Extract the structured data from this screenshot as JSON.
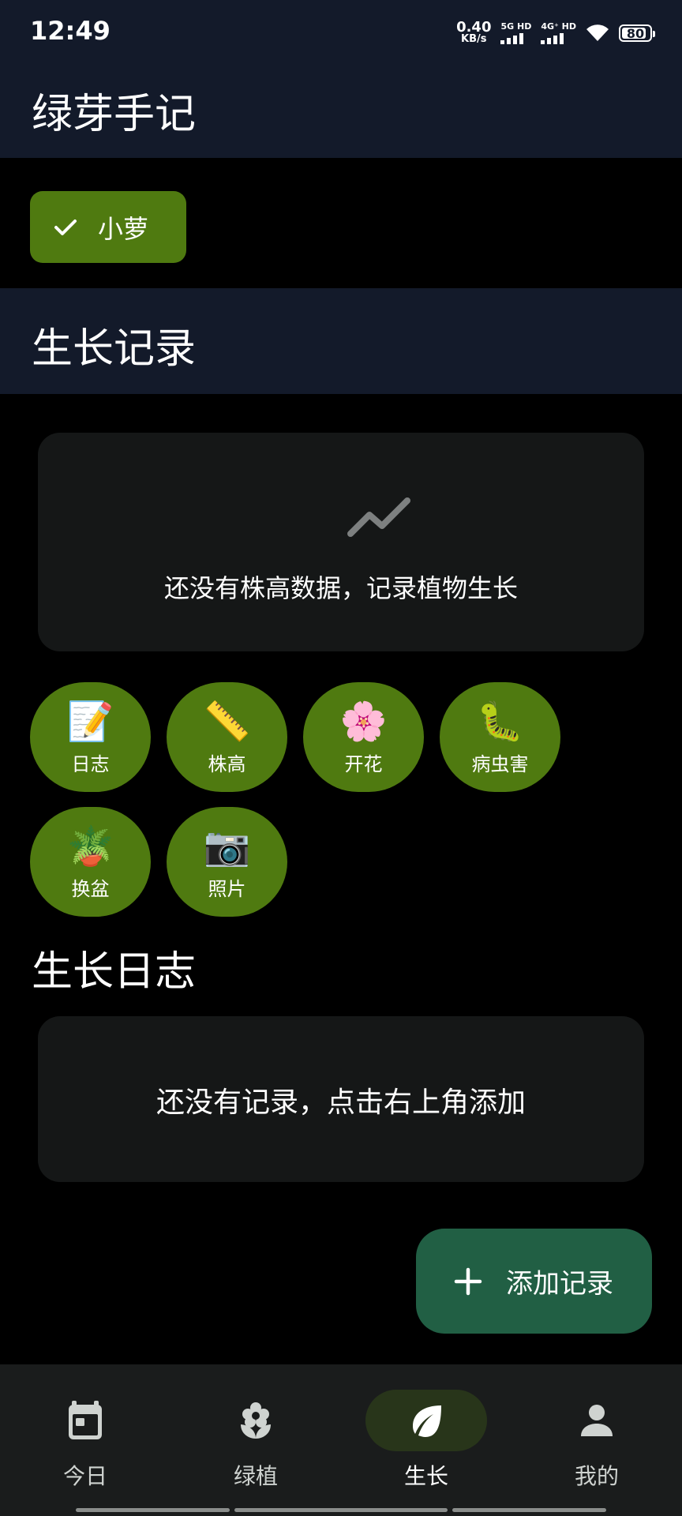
{
  "status_bar": {
    "time": "12:49",
    "net_speed_value": "0.40",
    "net_speed_unit": "KB/s",
    "signal_1_label": "5G HD",
    "signal_2_label": "4G⁺ HD",
    "battery": "80"
  },
  "app_bar": {
    "title": "绿芽手记"
  },
  "plant_chip": {
    "label": "小萝",
    "selected": true
  },
  "growth_section": {
    "title": "生长记录",
    "height_empty_text": "还没有株高数据，记录植物生长"
  },
  "actions": [
    {
      "emoji": "📝",
      "label": "日志"
    },
    {
      "emoji": "📏",
      "label": "株高"
    },
    {
      "emoji": "🌸",
      "label": "开花"
    },
    {
      "emoji": "🐛",
      "label": "病虫害"
    },
    {
      "emoji": "🪴",
      "label": "换盆"
    },
    {
      "emoji": "📷",
      "label": "照片"
    }
  ],
  "log_section": {
    "title": "生长日志",
    "empty_text": "还没有记录，点击右上角添加"
  },
  "fab": {
    "label": "添加记录"
  },
  "bottom_nav": [
    {
      "label": "今日",
      "icon": "calendar-icon"
    },
    {
      "label": "绿植",
      "icon": "flower-icon"
    },
    {
      "label": "生长",
      "icon": "leaf-icon",
      "active": true
    },
    {
      "label": "我的",
      "icon": "person-icon"
    }
  ],
  "colors": {
    "background": "#000000",
    "header": "#131a2a",
    "accent_green": "#4f7a10",
    "fab_green": "#215f44",
    "card": "#151717",
    "nav": "#1a1c1c"
  }
}
